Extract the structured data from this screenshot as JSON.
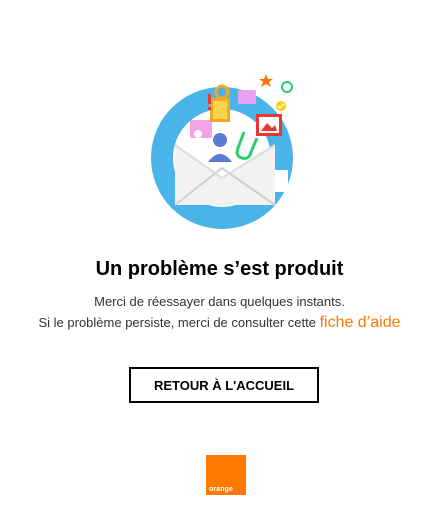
{
  "error": {
    "title": "Un problème s’est produit",
    "line1": "Merci de réessayer dans quelques instants.",
    "line2_prefix": "Si le problème persiste, merci de consulter cette ",
    "help_link": "fiche d’aide"
  },
  "button": {
    "label": "RETOUR À L'ACCUEIL"
  },
  "brand": {
    "logo_text": "orange",
    "color": "#ff7900"
  },
  "illustration": {
    "name": "envelope-with-files-icon",
    "colors": {
      "ring": "#4ab3e8",
      "envelope": "#f2f2f2",
      "accent": "#ff7900"
    }
  }
}
